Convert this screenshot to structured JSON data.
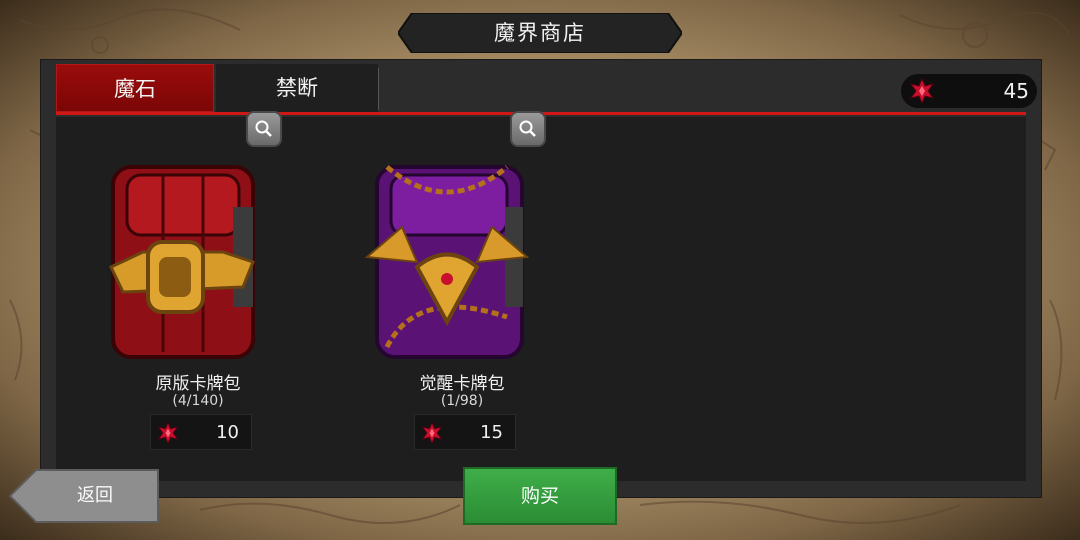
{
  "title": "魔界商店",
  "tabs": [
    {
      "label": "魔石",
      "active": true
    },
    {
      "label": "禁断",
      "active": false
    }
  ],
  "currency": {
    "icon": "red-gem-icon",
    "amount": "45"
  },
  "items": [
    {
      "name": "原版卡牌包",
      "count": "(4/140)",
      "price": "10",
      "chest": "red-chest",
      "color": "#a3161b"
    },
    {
      "name": "觉醒卡牌包",
      "count": "(1/98)",
      "price": "15",
      "chest": "purple-chained-chest",
      "color": "#6a1585"
    }
  ],
  "buttons": {
    "back": "返回",
    "buy": "购买"
  },
  "colors": {
    "accent_red": "#d01818",
    "buy_green": "#3fae49",
    "panel": "#2c2c2c"
  }
}
